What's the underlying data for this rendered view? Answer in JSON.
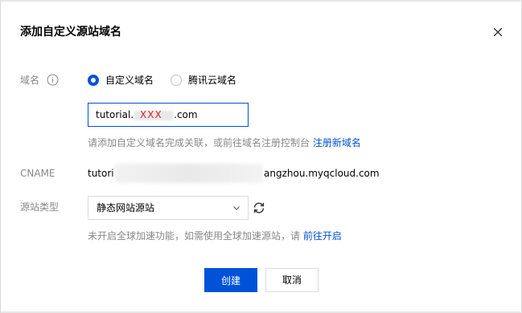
{
  "dialog": {
    "title": "添加自定义源站域名"
  },
  "form": {
    "domain_label": "域名",
    "radio_custom": "自定义域名",
    "radio_tencent": "腾讯云域名",
    "domain_value_prefix": "tutorial.",
    "domain_value_redacted": "XXX",
    "domain_value_suffix": ".com",
    "domain_hint": "请添加自定义域名完成关联，或前往域名注册控制台",
    "domain_hint_link": "注册新域名",
    "cname_label": "CNAME",
    "cname_value_prefix": "tutori",
    "cname_value_suffix": "angzhou.myqcloud.com",
    "origin_type_label": "源站类型",
    "origin_type_selected": "静态网站源站",
    "origin_hint": "未开启全球加速功能，如需使用全球加速源站，请",
    "origin_hint_link": "前往开启"
  },
  "footer": {
    "create_label": "创建",
    "cancel_label": "取消"
  },
  "colors": {
    "primary": "#0052d9",
    "muted_text": "#888888",
    "annotation_red": "#e02020"
  },
  "icons": {
    "close": "close-icon",
    "info": "info-icon",
    "chevron": "chevron-down-icon",
    "refresh": "refresh-icon"
  }
}
